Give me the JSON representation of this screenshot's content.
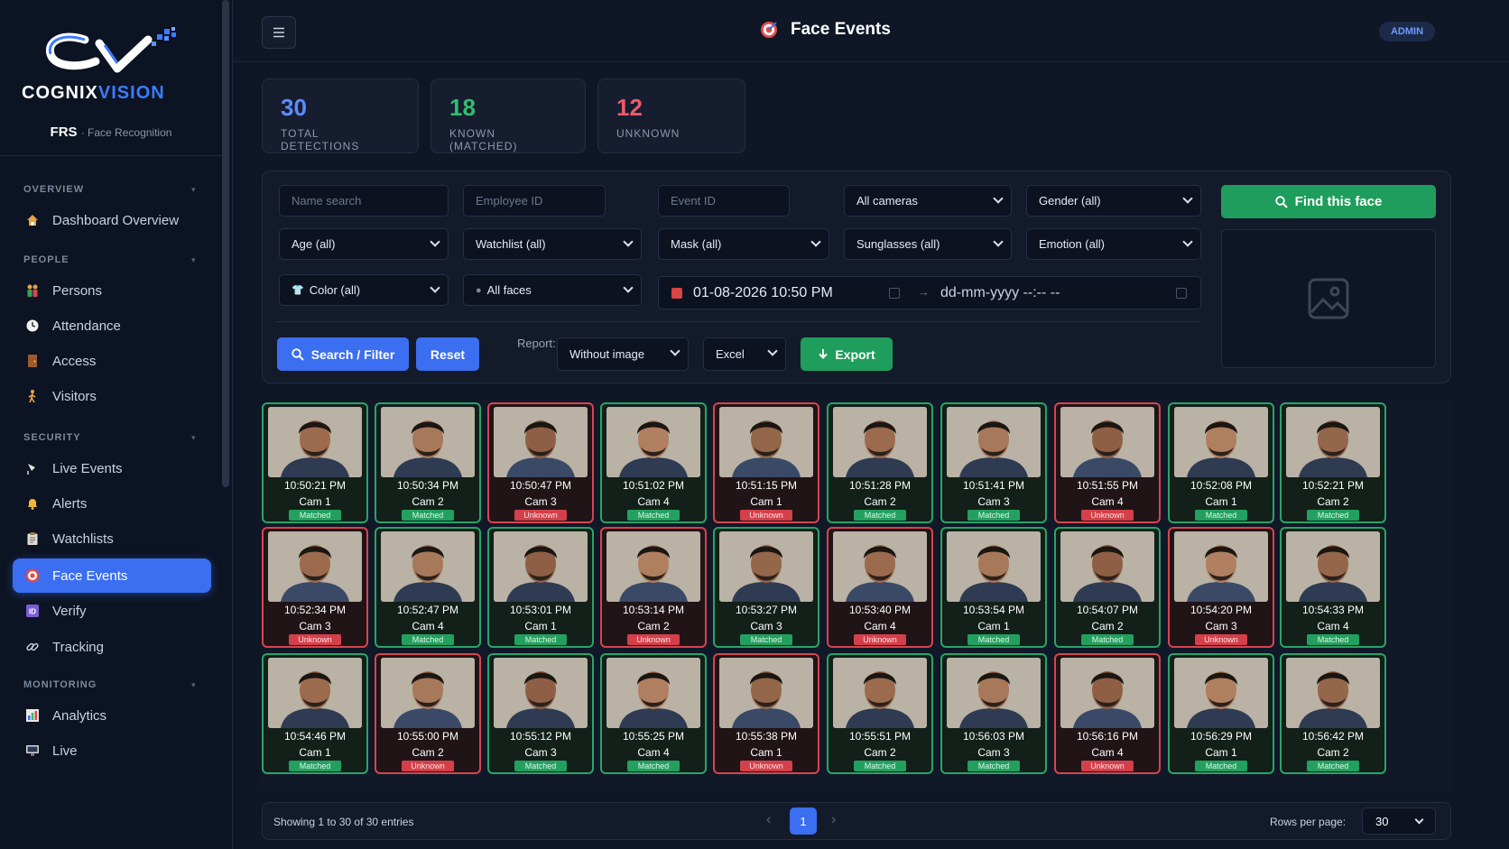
{
  "brand": {
    "name_part1": "COGNIX",
    "name_part2": "VISION",
    "app": "FRS",
    "app_sub": "· Face Recognition"
  },
  "sidebar": {
    "sections": [
      {
        "title": "OVERVIEW",
        "items": [
          {
            "label": "Dashboard Overview",
            "icon": "home-icon"
          }
        ]
      },
      {
        "title": "PEOPLE",
        "items": [
          {
            "label": "Persons",
            "icon": "people-icon"
          },
          {
            "label": "Attendance",
            "icon": "clock-icon"
          },
          {
            "label": "Access",
            "icon": "door-icon"
          },
          {
            "label": "Visitors",
            "icon": "walker-icon"
          }
        ]
      },
      {
        "title": "SECURITY",
        "items": [
          {
            "label": "Live Events",
            "icon": "camera-icon"
          },
          {
            "label": "Alerts",
            "icon": "bell-icon"
          },
          {
            "label": "Watchlists",
            "icon": "clipboard-icon"
          },
          {
            "label": "Face Events",
            "icon": "target-icon",
            "active": true
          },
          {
            "label": "Verify",
            "icon": "id-icon"
          },
          {
            "label": "Tracking",
            "icon": "link-icon"
          }
        ]
      },
      {
        "title": "MONITORING",
        "items": [
          {
            "label": "Analytics",
            "icon": "bar-chart-icon"
          },
          {
            "label": "Live",
            "icon": "screen-icon"
          }
        ]
      }
    ]
  },
  "header": {
    "title": "Face Events",
    "badge": "ADMIN"
  },
  "stats": [
    {
      "value": "30",
      "label": "TOTAL DETECTIONS",
      "color": "#5b8cff"
    },
    {
      "value": "18",
      "label": "KNOWN (MATCHED)",
      "color": "#2fbf71"
    },
    {
      "value": "12",
      "label": "UNKNOWN",
      "color": "#ef5a6a"
    }
  ],
  "filters": {
    "name_search_placeholder": "Name search",
    "employee_id_placeholder": "Employee ID",
    "event_id_placeholder": "Event ID",
    "cameras": "All cameras",
    "gender": "Gender (all)",
    "age": "Age (all)",
    "watchlist": "Watchlist (all)",
    "mask": "Mask (all)",
    "sunglasses": "Sunglasses (all)",
    "emotion": "Emotion (all)",
    "color": "Color (all)",
    "faces": "All faces",
    "date_from": "01-08-2026 10:50 PM",
    "date_to": "dd-mm-yyyy --:-- --",
    "search_btn": "Search / Filter",
    "reset_btn": "Reset",
    "report_label": "Report:",
    "report_option": "Without image",
    "format_option": "Excel",
    "export_btn": "Export",
    "find_btn": "Find this face"
  },
  "events": [
    {
      "time": "10:50:21 PM",
      "cam": "Cam 1",
      "status": "Matched"
    },
    {
      "time": "10:50:34 PM",
      "cam": "Cam 2",
      "status": "Matched"
    },
    {
      "time": "10:50:47 PM",
      "cam": "Cam 3",
      "status": "Unknown"
    },
    {
      "time": "10:51:02 PM",
      "cam": "Cam 4",
      "status": "Matched"
    },
    {
      "time": "10:51:15 PM",
      "cam": "Cam 1",
      "status": "Unknown"
    },
    {
      "time": "10:51:28 PM",
      "cam": "Cam 2",
      "status": "Matched"
    },
    {
      "time": "10:51:41 PM",
      "cam": "Cam 3",
      "status": "Matched"
    },
    {
      "time": "10:51:55 PM",
      "cam": "Cam 4",
      "status": "Unknown"
    },
    {
      "time": "10:52:08 PM",
      "cam": "Cam 1",
      "status": "Matched"
    },
    {
      "time": "10:52:21 PM",
      "cam": "Cam 2",
      "status": "Matched"
    },
    {
      "time": "10:52:34 PM",
      "cam": "Cam 3",
      "status": "Unknown"
    },
    {
      "time": "10:52:47 PM",
      "cam": "Cam 4",
      "status": "Matched"
    },
    {
      "time": "10:53:01 PM",
      "cam": "Cam 1",
      "status": "Matched"
    },
    {
      "time": "10:53:14 PM",
      "cam": "Cam 2",
      "status": "Unknown"
    },
    {
      "time": "10:53:27 PM",
      "cam": "Cam 3",
      "status": "Matched"
    },
    {
      "time": "10:53:40 PM",
      "cam": "Cam 4",
      "status": "Unknown"
    },
    {
      "time": "10:53:54 PM",
      "cam": "Cam 1",
      "status": "Matched"
    },
    {
      "time": "10:54:07 PM",
      "cam": "Cam 2",
      "status": "Matched"
    },
    {
      "time": "10:54:20 PM",
      "cam": "Cam 3",
      "status": "Unknown"
    },
    {
      "time": "10:54:33 PM",
      "cam": "Cam 4",
      "status": "Matched"
    },
    {
      "time": "10:54:46 PM",
      "cam": "Cam 1",
      "status": "Matched"
    },
    {
      "time": "10:55:00 PM",
      "cam": "Cam 2",
      "status": "Unknown"
    },
    {
      "time": "10:55:12 PM",
      "cam": "Cam 3",
      "status": "Matched"
    },
    {
      "time": "10:55:25 PM",
      "cam": "Cam 4",
      "status": "Matched"
    },
    {
      "time": "10:55:38 PM",
      "cam": "Cam 1",
      "status": "Unknown"
    },
    {
      "time": "10:55:51 PM",
      "cam": "Cam 2",
      "status": "Matched"
    },
    {
      "time": "10:56:03 PM",
      "cam": "Cam 3",
      "status": "Matched"
    },
    {
      "time": "10:56:16 PM",
      "cam": "Cam 4",
      "status": "Unknown"
    },
    {
      "time": "10:56:29 PM",
      "cam": "Cam 1",
      "status": "Matched"
    },
    {
      "time": "10:56:42 PM",
      "cam": "Cam 2",
      "status": "Matched"
    }
  ],
  "footer": {
    "showing": "Showing 1 to 30 of 30 entries",
    "page": "1",
    "rows_label": "Rows per page:",
    "rows_value": "30"
  },
  "colors": {
    "accent": "#3b6ef0",
    "matched": "#2aa36a",
    "unknown": "#d64550"
  }
}
